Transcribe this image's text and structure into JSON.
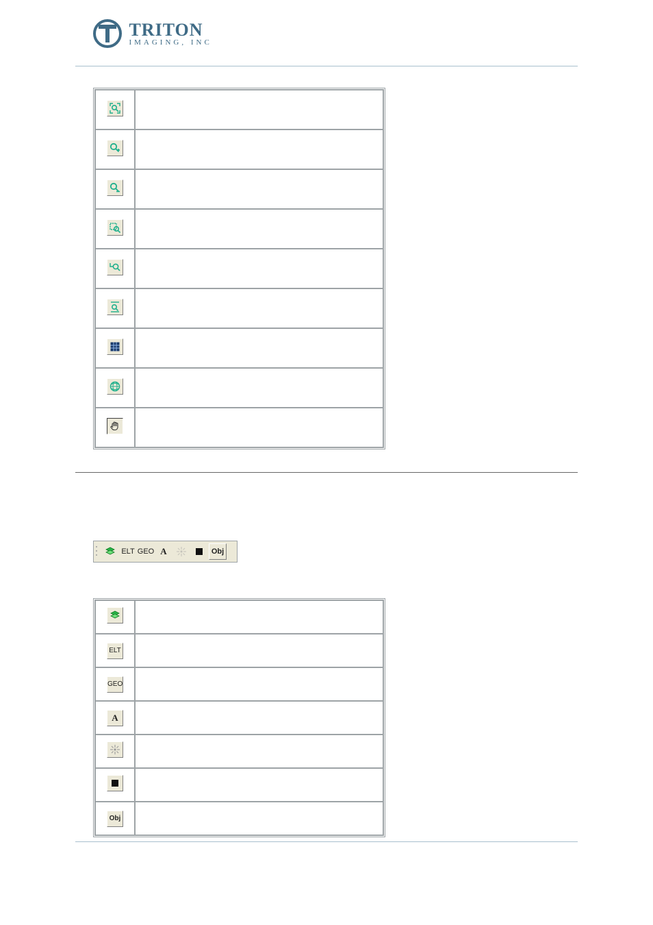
{
  "header": {
    "brand": "TRITON",
    "subline": "IMAGING, INC"
  },
  "tables": {
    "zoom": {
      "rows": [
        {
          "icon": "zoom-extent-icon",
          "desc": ""
        },
        {
          "icon": "zoom-in-icon",
          "desc": ""
        },
        {
          "icon": "zoom-out-icon",
          "desc": ""
        },
        {
          "icon": "zoom-box-icon",
          "desc": ""
        },
        {
          "icon": "zoom-prev-icon",
          "desc": ""
        },
        {
          "icon": "zoom-height-icon",
          "desc": ""
        },
        {
          "icon": "grid-icon",
          "desc": ""
        },
        {
          "icon": "globe-icon",
          "desc": ""
        },
        {
          "icon": "pan-hand-icon",
          "desc": ""
        }
      ]
    },
    "layers": {
      "rows": [
        {
          "icon": "layers-icon",
          "label": "",
          "desc": ""
        },
        {
          "icon": "elt-label",
          "label": "ELT",
          "desc": ""
        },
        {
          "icon": "geo-label",
          "label": "GEO",
          "desc": ""
        },
        {
          "icon": "a-label",
          "label": "A",
          "desc": ""
        },
        {
          "icon": "trackpoint-icon",
          "label": "",
          "desc": ""
        },
        {
          "icon": "stop-icon",
          "label": "",
          "desc": ""
        },
        {
          "icon": "obj-label",
          "label": "Obj",
          "desc": ""
        }
      ]
    }
  },
  "toolbar_fig": {
    "items": [
      {
        "icon": "layers-icon",
        "label": ""
      },
      {
        "icon": "elt-label",
        "label": "ELT"
      },
      {
        "icon": "geo-label",
        "label": "GEO"
      },
      {
        "icon": "a-label",
        "label": "A"
      },
      {
        "icon": "trackpoint-icon",
        "label": "",
        "disabled": true
      },
      {
        "icon": "stop-icon",
        "label": ""
      },
      {
        "icon": "obj-label",
        "label": "Obj"
      }
    ]
  }
}
